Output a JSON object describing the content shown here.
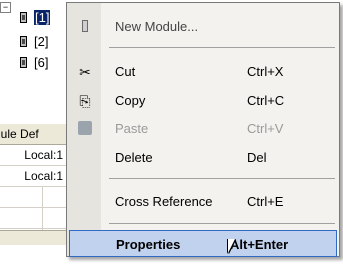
{
  "tree": {
    "items": [
      {
        "label": "[1]",
        "selected": true
      },
      {
        "label": "[2]",
        "selected": false
      },
      {
        "label": "[6]",
        "selected": false
      }
    ]
  },
  "grid": {
    "header": "dule Def",
    "rows": [
      "Local:1",
      "Local:1"
    ]
  },
  "context_menu": {
    "items": [
      {
        "label": "New Module...",
        "shortcut": "",
        "icon": "module-icon",
        "disabled": false
      },
      {
        "label": "Cut",
        "shortcut": "Ctrl+X",
        "icon": "scissors-icon",
        "disabled": false
      },
      {
        "label": "Copy",
        "shortcut": "Ctrl+C",
        "icon": "copy-icon",
        "disabled": false
      },
      {
        "label": "Paste",
        "shortcut": "Ctrl+V",
        "icon": "paste-icon",
        "disabled": true
      },
      {
        "label": "Delete",
        "shortcut": "Del",
        "icon": "",
        "disabled": false
      },
      {
        "label": "Cross Reference",
        "shortcut": "Ctrl+E",
        "icon": "",
        "disabled": false
      },
      {
        "label": "Properties",
        "shortcut": "Alt+Enter",
        "icon": "",
        "disabled": false,
        "highlighted": true
      }
    ]
  },
  "colors": {
    "menu_bg": "#f3f2ef",
    "highlight_bg": "#c1d2ee",
    "highlight_border": "#316ac5",
    "disabled_text": "#9a9a9a",
    "selection_bg": "#0a246a"
  }
}
